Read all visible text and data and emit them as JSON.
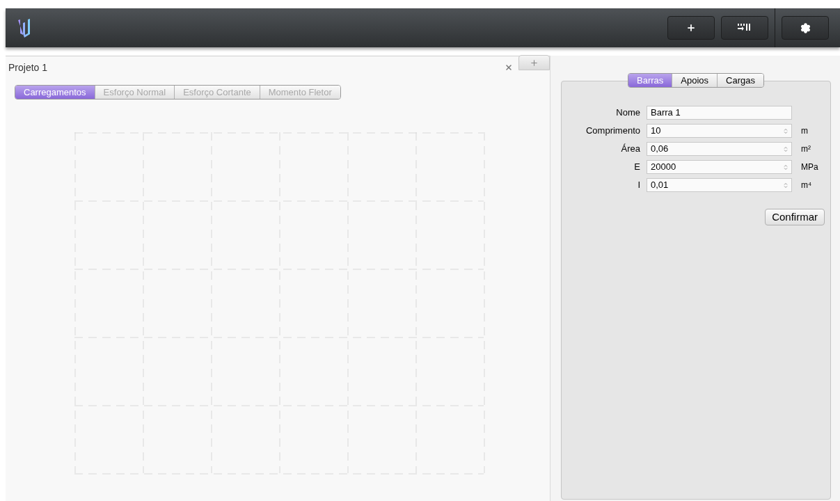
{
  "toolbar": {
    "buttons": [
      {
        "kind": "add"
      },
      {
        "kind": "import"
      },
      {
        "kind": "settings"
      }
    ]
  },
  "document_tabs": [
    {
      "label": "Projeto 1",
      "selected": true
    }
  ],
  "view_tabs": [
    {
      "label": "Carregamentos",
      "selected": true
    },
    {
      "label": "Esforço Normal",
      "selected": false
    },
    {
      "label": "Esforço Cortante",
      "selected": false
    },
    {
      "label": "Momento Fletor",
      "selected": false
    }
  ],
  "panel_tabs": [
    {
      "label": "Barras",
      "selected": true
    },
    {
      "label": "Apoios",
      "selected": false
    },
    {
      "label": "Cargas",
      "selected": false
    }
  ],
  "form": {
    "fields": [
      {
        "label": "Nome",
        "value": "Barra 1",
        "kind": "text"
      },
      {
        "label": "Comprimento",
        "value": "10",
        "kind": "number",
        "unit": "m"
      },
      {
        "label": "Área",
        "value": "0,06",
        "kind": "number",
        "unit": "m²"
      },
      {
        "label": "E",
        "value": "20000",
        "kind": "number",
        "unit": "MPa"
      },
      {
        "label": "I",
        "value": "0,01",
        "kind": "number",
        "unit": "m⁴"
      }
    ],
    "button": "Confirmar"
  }
}
